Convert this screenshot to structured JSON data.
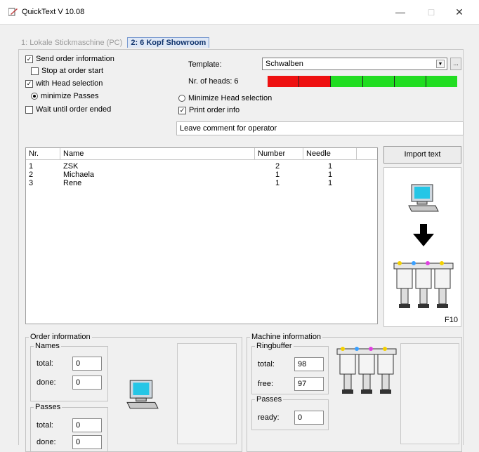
{
  "window": {
    "title": "QuickText V 10.08",
    "controls": {
      "minimize": "—",
      "maximize": "□",
      "close": "✕"
    }
  },
  "tabs": [
    {
      "label": "1: Lokale Stickmaschine (PC)",
      "active": false
    },
    {
      "label": "2: 6 Kopf Showroom",
      "active": true
    }
  ],
  "options": {
    "send_order_info": {
      "label": "Send order information",
      "checked": true
    },
    "stop_at_order_start": {
      "label": "Stop at order start",
      "checked": false
    },
    "with_head_selection": {
      "label": "with Head selection",
      "checked": true
    },
    "minimize_passes": {
      "label": "minimize Passes",
      "selected": true
    },
    "wait_until_order_ended": {
      "label": "Wait until order ended",
      "checked": false
    },
    "minimize_head_selection": {
      "label": "Minimize Head selection",
      "selected": false
    },
    "print_order_info": {
      "label": "Print order info",
      "checked": true
    }
  },
  "template": {
    "label": "Template:",
    "value": "Schwalben",
    "dots": "..."
  },
  "heads": {
    "label": "Nr. of heads: 6",
    "status": [
      "#ee1111",
      "#ee1111",
      "#22dd22",
      "#22dd22",
      "#22dd22",
      "#22dd22"
    ]
  },
  "comment": {
    "value": "Leave comment for operator"
  },
  "table": {
    "columns": [
      "Nr.",
      "Name",
      "Number",
      "Needle"
    ],
    "rows": [
      {
        "nr": "1",
        "name": "ZSK",
        "number": "2",
        "needle": "1"
      },
      {
        "nr": "2",
        "name": "Michaela",
        "number": "1",
        "needle": "1"
      },
      {
        "nr": "3",
        "name": "Rene",
        "number": "1",
        "needle": "1"
      }
    ]
  },
  "import": {
    "label": "Import text",
    "hotkey": "F10"
  },
  "order_info": {
    "title": "Order information",
    "names": {
      "title": "Names",
      "total_label": "total:",
      "total": "0",
      "done_label": "done:",
      "done": "0"
    },
    "passes": {
      "title": "Passes",
      "total_label": "total:",
      "total": "0",
      "done_label": "done:",
      "done": "0"
    }
  },
  "machine_info": {
    "title": "Machine information",
    "ringbuffer": {
      "title": "Ringbuffer",
      "total_label": "total:",
      "total": "98",
      "free_label": "free:",
      "free": "97"
    },
    "passes": {
      "title": "Passes",
      "ready_label": "ready:",
      "ready": "0"
    }
  },
  "icons": {
    "app": "quicktext-app-icon",
    "computer": "computer-icon",
    "arrow": "arrow-down-icon",
    "machine": "embroidery-machine-icon"
  },
  "colors": {
    "tab_active_bg": "#dfe8f6",
    "tab_active_text": "#12356e"
  }
}
